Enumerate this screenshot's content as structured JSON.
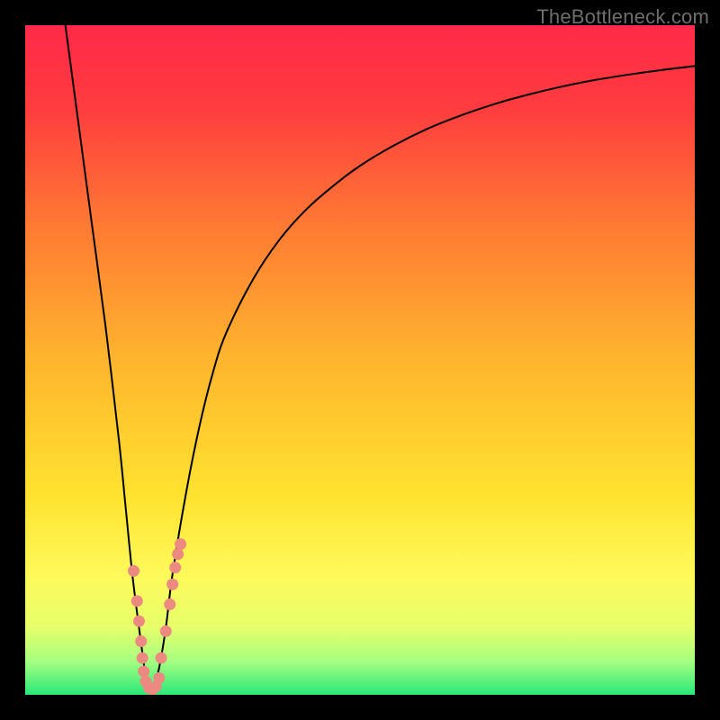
{
  "watermark": "TheBottleneck.com",
  "chart_data": {
    "type": "line",
    "title": "",
    "xlabel": "",
    "ylabel": "",
    "xlim": [
      0,
      100
    ],
    "ylim": [
      0,
      100
    ],
    "background_gradient": {
      "stops": [
        {
          "offset": 0.0,
          "color": "#ff2a49"
        },
        {
          "offset": 0.12,
          "color": "#ff3b3f"
        },
        {
          "offset": 0.3,
          "color": "#ff7a33"
        },
        {
          "offset": 0.5,
          "color": "#ffb52e"
        },
        {
          "offset": 0.7,
          "color": "#ffe22f"
        },
        {
          "offset": 0.82,
          "color": "#fff95a"
        },
        {
          "offset": 0.9,
          "color": "#e6ff6a"
        },
        {
          "offset": 0.95,
          "color": "#a6ff80"
        },
        {
          "offset": 1.0,
          "color": "#29e87a"
        }
      ]
    },
    "series": [
      {
        "name": "bottleneck-curve",
        "type": "line",
        "color": "#000000",
        "x": [
          6,
          8,
          10,
          12,
          14,
          15,
          16,
          17,
          17.8,
          18.3,
          18.8,
          19.2,
          20,
          21,
          22,
          24,
          26,
          28,
          30,
          34,
          38,
          42,
          46,
          50,
          55,
          60,
          65,
          70,
          75,
          80,
          85,
          90,
          95,
          100
        ],
        "y": [
          100,
          85,
          70,
          55,
          38,
          28,
          18,
          10,
          4,
          1,
          0.5,
          1,
          4,
          10,
          18,
          30,
          40,
          48,
          54,
          62,
          68,
          72.5,
          76,
          79,
          82,
          84.5,
          86.5,
          88.2,
          89.6,
          90.8,
          91.8,
          92.6,
          93.3,
          93.9
        ]
      },
      {
        "name": "left-markers",
        "type": "scatter",
        "color": "#ec8a82",
        "x": [
          16.2,
          16.7,
          17.0,
          17.3,
          17.5,
          17.7
        ],
        "y": [
          18.5,
          14.0,
          11.0,
          8.0,
          5.5,
          3.5
        ]
      },
      {
        "name": "right-markers",
        "type": "scatter",
        "color": "#ec8a82",
        "x": [
          21.0,
          21.6,
          22.0,
          22.4,
          22.8,
          23.2,
          20.3
        ],
        "y": [
          9.5,
          13.5,
          16.5,
          19.0,
          21.0,
          22.5,
          5.5
        ]
      },
      {
        "name": "bottom-markers",
        "type": "scatter",
        "color": "#ec8a82",
        "x": [
          18.0,
          18.5,
          19.0,
          19.5,
          20.0
        ],
        "y": [
          2.0,
          1.0,
          0.8,
          1.2,
          2.5
        ]
      }
    ]
  }
}
